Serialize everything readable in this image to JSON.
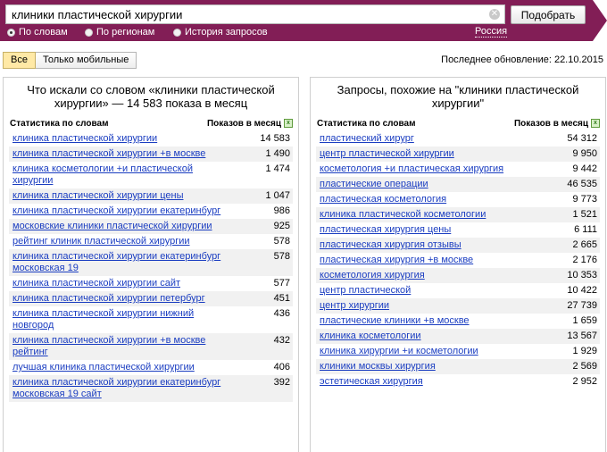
{
  "colors": {
    "header_bg": "#821e56",
    "link": "#1a3dc1",
    "active_filter": "#ffe9a6"
  },
  "search": {
    "value": "клиники пластической хирургии",
    "clear_icon": "clear-icon",
    "submit_label": "Подобрать"
  },
  "modes": [
    {
      "label": "По словам",
      "checked": true
    },
    {
      "label": "По регионам",
      "checked": false
    },
    {
      "label": "История запросов",
      "checked": false
    }
  ],
  "region": "Россия",
  "filter": {
    "all_label": "Все",
    "mobile_label": "Только мобильные"
  },
  "last_update": "Последнее обновление: 22.10.2015",
  "left_panel": {
    "title": "Что искали со словом «клиники пластической хирургии» — 14 583 показа в месяц",
    "col_words": "Статистика по словам",
    "col_shows": "Показов в месяц",
    "rows": [
      {
        "phrase": "клиника пластической хирургии",
        "count": "14 583"
      },
      {
        "phrase": "клиника пластической хирургии +в москве",
        "count": "1 490"
      },
      {
        "phrase": "клиника косметологии +и пластической хирургии",
        "count": "1 474"
      },
      {
        "phrase": "клиника пластической хирургии цены",
        "count": "1 047"
      },
      {
        "phrase": "клиника пластической хирургии екатеринбург",
        "count": "986"
      },
      {
        "phrase": "московские клиники пластической хирургии",
        "count": "925"
      },
      {
        "phrase": "рейтинг клиник пластической хирургии",
        "count": "578"
      },
      {
        "phrase": "клиника пластической хирургии екатеринбург московская 19",
        "count": "578"
      },
      {
        "phrase": "клиника пластической хирургии сайт",
        "count": "577"
      },
      {
        "phrase": "клиника пластической хирургии петербург",
        "count": "451"
      },
      {
        "phrase": "клиника пластической хирургии нижний новгород",
        "count": "436"
      },
      {
        "phrase": "клиника пластической хирургии +в москве рейтинг",
        "count": "432"
      },
      {
        "phrase": "лучшая клиника пластической хирургии",
        "count": "406"
      },
      {
        "phrase": "клиника пластической хирургии екатеринбург московская 19 сайт",
        "count": "392"
      }
    ]
  },
  "right_panel": {
    "title": "Запросы, похожие на \"клиники пластической хирургии\"",
    "col_words": "Статистика по словам",
    "col_shows": "Показов в месяц",
    "rows": [
      {
        "phrase": "пластический хирург",
        "count": "54 312"
      },
      {
        "phrase": "центр пластической хирургии",
        "count": "9 950"
      },
      {
        "phrase": "косметология +и пластическая хирургия",
        "count": "9 442"
      },
      {
        "phrase": "пластические операции",
        "count": "46 535"
      },
      {
        "phrase": "пластическая косметология",
        "count": "9 773"
      },
      {
        "phrase": "клиника пластической косметологии",
        "count": "1 521"
      },
      {
        "phrase": "пластическая хирургия цены",
        "count": "6 111"
      },
      {
        "phrase": "пластическая хирургия отзывы",
        "count": "2 665"
      },
      {
        "phrase": "пластическая хирургия +в москве",
        "count": "2 176"
      },
      {
        "phrase": "косметология хирургия",
        "count": "10 353"
      },
      {
        "phrase": "центр пластической",
        "count": "10 422"
      },
      {
        "phrase": "центр хирургии",
        "count": "27 739"
      },
      {
        "phrase": "пластические клиники +в москве",
        "count": "1 659"
      },
      {
        "phrase": "клиника косметологии",
        "count": "13 567"
      },
      {
        "phrase": "клиника хирургии +и косметологии",
        "count": "1 929"
      },
      {
        "phrase": "клиники москвы хирургия",
        "count": "2 569"
      },
      {
        "phrase": "эстетическая хирургия",
        "count": "2 952"
      }
    ]
  }
}
